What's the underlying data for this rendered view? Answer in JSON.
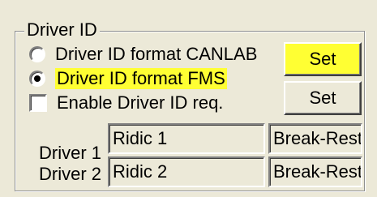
{
  "group": {
    "title": "Driver ID"
  },
  "options": {
    "format_canlab": "Driver ID format CANLAB",
    "format_fms": "Driver ID format FMS",
    "enable_req": "Enable Driver ID req."
  },
  "buttons": {
    "set_top": "Set",
    "set_bottom": "Set"
  },
  "drivers": [
    {
      "label": "Driver 1",
      "name": "Ridic 1",
      "status": "Break-Rest"
    },
    {
      "label": "Driver 2",
      "name": "Ridic 2",
      "status": "Break-Rest"
    }
  ],
  "colors": {
    "highlight": "#ffff33",
    "panel": "#ece9d8"
  }
}
